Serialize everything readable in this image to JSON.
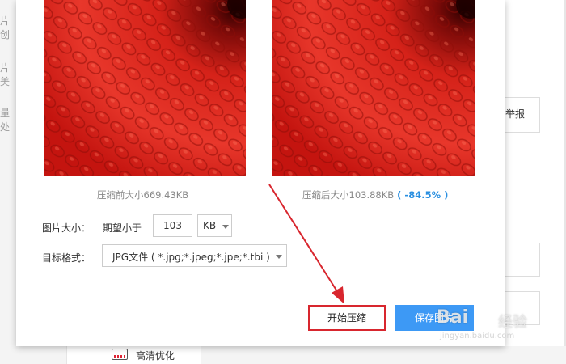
{
  "background": {
    "left_fragments": [
      "片创",
      "片美",
      "量处"
    ],
    "right_report_label": "举报",
    "hd_button_label": "高清优化"
  },
  "dialog": {
    "before_caption": "压缩前大小669.43KB",
    "after_caption": "压缩后大小103.88KB",
    "after_percent": "( -84.5% )",
    "size_row": {
      "label": "图片大小：",
      "expect_label": "期望小于",
      "value": "103",
      "unit": "KB"
    },
    "format_row": {
      "label": "目标格式：",
      "selected": "JPG文件 ( *.jpg;*.jpeg;*.jpe;*.tbi )"
    },
    "buttons": {
      "start": "开始压缩",
      "save": "保存图片"
    }
  },
  "watermark": {
    "logo": "Bai",
    "text": "经验",
    "url": "jingyan.baidu.com"
  },
  "colors": {
    "accent_blue": "#3d99f5",
    "highlight_red": "#d8262e",
    "percent_blue": "#2a8fe0"
  }
}
